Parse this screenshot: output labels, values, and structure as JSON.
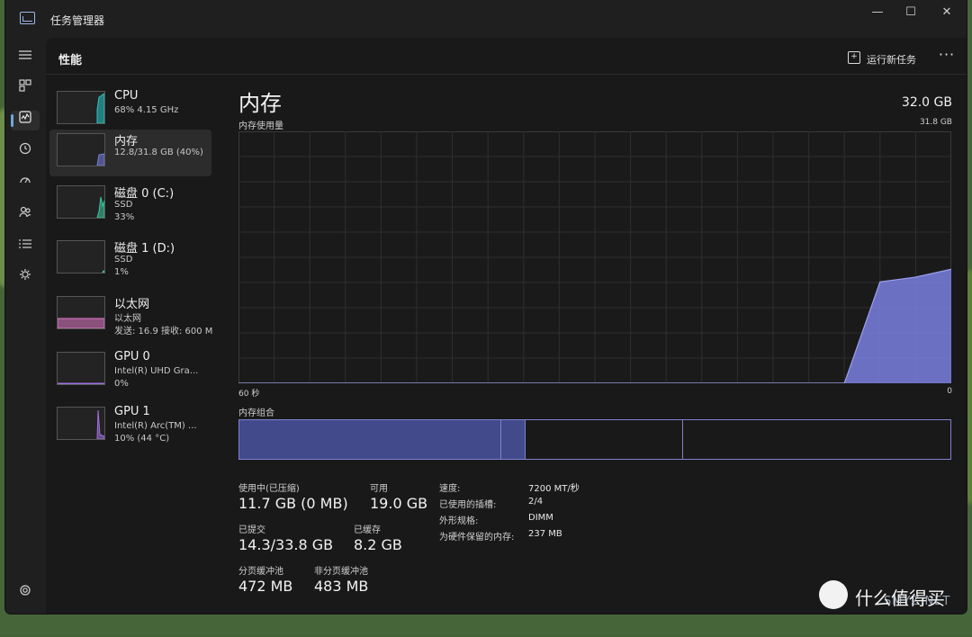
{
  "window": {
    "title": "任务管理器",
    "minimize_glyph": "—",
    "maximize_glyph": "☐",
    "close_glyph": "✕"
  },
  "header": {
    "page_title": "性能",
    "run_task_label": "运行新任务",
    "more_glyph": "···"
  },
  "nav_icons": [
    "hamburger-icon",
    "processes-icon",
    "performance-icon",
    "history-icon",
    "startup-icon",
    "users-icon",
    "details-icon",
    "services-icon",
    "settings-icon"
  ],
  "resources": [
    {
      "name": "CPU",
      "line1": "68%  4.15 GHz",
      "line2": "",
      "color": "#28c8c8",
      "selected": false
    },
    {
      "name": "内存",
      "line1": "12.8/31.8 GB (40%)",
      "line2": "",
      "color": "#7a80e0",
      "selected": true
    },
    {
      "name": "磁盘 0 (C:)",
      "line1": "SSD",
      "line2": "33%",
      "color": "#3cc8a0",
      "selected": false
    },
    {
      "name": "磁盘 1 (D:)",
      "line1": "SSD",
      "line2": "1%",
      "color": "#3cc8a0",
      "selected": false
    },
    {
      "name": "以太网",
      "line1": "以太网",
      "line2": "发送: 16.9  接收: 600 M",
      "color": "#e078c8",
      "selected": false
    },
    {
      "name": "GPU 0",
      "line1": "Intel(R) UHD Gra...",
      "line2": "0%",
      "color": "#a070e0",
      "selected": false
    },
    {
      "name": "GPU 1",
      "line1": "Intel(R) Arc(TM) ...",
      "line2": "10% (44 °C)",
      "color": "#a070e0",
      "selected": false
    }
  ],
  "main": {
    "title": "内存",
    "total": "32.0 GB",
    "usage_label": "内存使用量",
    "usage_max": "31.8 GB",
    "axis_left": "60 秒",
    "axis_right": "0",
    "composition_label": "内存组合"
  },
  "chart_data": {
    "type": "area",
    "x": [
      60,
      9,
      6,
      3,
      0
    ],
    "values": [
      0,
      0,
      12.8,
      13.4,
      14.4
    ],
    "ylim": [
      0,
      31.8
    ],
    "grid": true,
    "color": "#7a80e0"
  },
  "composition": {
    "in_use_fraction": 0.368,
    "modified_fraction": 0.035,
    "standby_fraction": 0.221,
    "free_fraction": 0.376
  },
  "stats": {
    "in_use_label": "使用中(已压缩)",
    "in_use_value": "11.7 GB (0 MB)",
    "available_label": "可用",
    "available_value": "19.0 GB",
    "committed_label": "已提交",
    "committed_value": "14.3/33.8 GB",
    "cached_label": "已缓存",
    "cached_value": "8.2 GB",
    "paged_label": "分页缓冲池",
    "paged_value": "472 MB",
    "nonpaged_label": "非分页缓冲池",
    "nonpaged_value": "483 MB"
  },
  "specs": [
    {
      "key": "速度:",
      "value": "7200 MT/秒"
    },
    {
      "key": "已使用的插槽:",
      "value": "2/4"
    },
    {
      "key": "外形规格:",
      "value": "DIMM"
    },
    {
      "key": "为硬件保留的内存:",
      "value": "237 MB"
    }
  ],
  "watermark": {
    "text": "什么值得买",
    "sub": "SMYZ.NET"
  }
}
